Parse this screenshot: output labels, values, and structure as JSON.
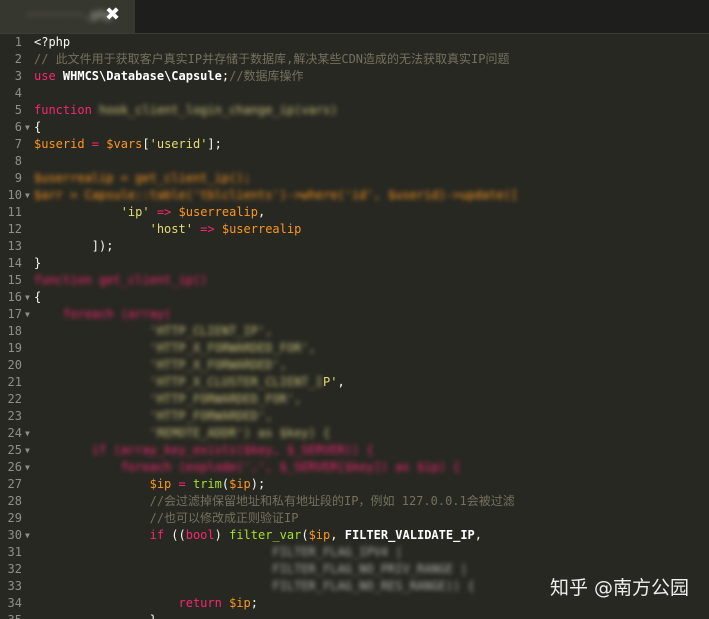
{
  "tab": {
    "title": "········.php",
    "close_icon": "close-icon"
  },
  "watermark": "知乎 @南方公园",
  "lines": [
    {
      "n": "1",
      "fold": false,
      "parts": [
        {
          "c": "pl",
          "t": "<?php"
        }
      ]
    },
    {
      "n": "2",
      "fold": false,
      "parts": [
        {
          "c": "cmt",
          "t": "// 此文件用于获取客户真实IP并存储于数据库,解决某些CDN造成的无法获取真实IP问题"
        }
      ]
    },
    {
      "n": "3",
      "fold": false,
      "parts": [
        {
          "c": "kw",
          "t": "use "
        },
        {
          "c": "cls",
          "t": "WHMCS\\Database\\Capsule"
        },
        {
          "c": "pl",
          "t": ";"
        },
        {
          "c": "cmt",
          "t": "//数据库操作"
        }
      ]
    },
    {
      "n": "4",
      "fold": false,
      "parts": []
    },
    {
      "n": "5",
      "fold": false,
      "parts": [
        {
          "c": "kw",
          "t": "function "
        },
        {
          "c": "blur",
          "t": "hook_client_login_change_ip(vars)"
        }
      ]
    },
    {
      "n": "6",
      "fold": true,
      "parts": [
        {
          "c": "pl",
          "t": "{"
        }
      ]
    },
    {
      "n": "7",
      "fold": false,
      "parts": [
        {
          "c": "var",
          "t": "$userid"
        },
        {
          "c": "op",
          "t": " = "
        },
        {
          "c": "var",
          "t": "$vars"
        },
        {
          "c": "pl",
          "t": "["
        },
        {
          "c": "str",
          "t": "'userid'"
        },
        {
          "c": "pl",
          "t": "];"
        }
      ]
    },
    {
      "n": "8",
      "fold": false,
      "parts": []
    },
    {
      "n": "9",
      "fold": false,
      "parts": [
        {
          "c": "blurv",
          "t": "$userrealip = get_client_ip();"
        }
      ]
    },
    {
      "n": "10",
      "fold": true,
      "parts": [
        {
          "c": "blurv",
          "t": "$arr = Capsule::table('tblclients')->where('id', $userid)->update(["
        }
      ]
    },
    {
      "n": "11",
      "fold": false,
      "parts": [
        {
          "c": "pl",
          "t": "            "
        },
        {
          "c": "str",
          "t": "'ip'"
        },
        {
          "c": "op",
          "t": " => "
        },
        {
          "c": "var",
          "t": "$userrealip"
        },
        {
          "c": "pl",
          "t": ","
        }
      ]
    },
    {
      "n": "12",
      "fold": false,
      "parts": [
        {
          "c": "pl",
          "t": "                "
        },
        {
          "c": "str",
          "t": "'host'"
        },
        {
          "c": "op",
          "t": " => "
        },
        {
          "c": "var",
          "t": "$userrealip"
        }
      ]
    },
    {
      "n": "13",
      "fold": false,
      "parts": [
        {
          "c": "pl",
          "t": "        ]);"
        }
      ]
    },
    {
      "n": "14",
      "fold": false,
      "parts": [
        {
          "c": "pl",
          "t": "}"
        }
      ]
    },
    {
      "n": "15",
      "fold": false,
      "parts": [
        {
          "c": "blurr",
          "t": "function get_client_ip()"
        }
      ]
    },
    {
      "n": "16",
      "fold": true,
      "parts": [
        {
          "c": "pl",
          "t": "{"
        }
      ]
    },
    {
      "n": "17",
      "fold": true,
      "parts": [
        {
          "c": "pl",
          "t": "    "
        },
        {
          "c": "blurr",
          "t": "foreach (array("
        }
      ]
    },
    {
      "n": "18",
      "fold": false,
      "parts": [
        {
          "c": "pl",
          "t": "                "
        },
        {
          "c": "blur",
          "t": "'HTTP_CLIENT_IP',"
        }
      ]
    },
    {
      "n": "19",
      "fold": false,
      "parts": [
        {
          "c": "pl",
          "t": "                "
        },
        {
          "c": "blur",
          "t": "'HTTP_X_FORWARDED_FOR',"
        }
      ]
    },
    {
      "n": "20",
      "fold": false,
      "parts": [
        {
          "c": "pl",
          "t": "                "
        },
        {
          "c": "blur",
          "t": "'HTTP_X_FORWARDED',"
        }
      ]
    },
    {
      "n": "21",
      "fold": false,
      "parts": [
        {
          "c": "pl",
          "t": "                "
        },
        {
          "c": "blur",
          "t": "'HTTP_X_CLUSTER_CLIENT_I"
        },
        {
          "c": "str",
          "t": "P'"
        },
        {
          "c": "pl",
          "t": ","
        }
      ]
    },
    {
      "n": "22",
      "fold": false,
      "parts": [
        {
          "c": "pl",
          "t": "                "
        },
        {
          "c": "blur",
          "t": "'HTTP_FORWARDED_FOR',"
        }
      ]
    },
    {
      "n": "23",
      "fold": false,
      "parts": [
        {
          "c": "pl",
          "t": "                "
        },
        {
          "c": "blur",
          "t": "'HTTP_FORWARDED',"
        }
      ]
    },
    {
      "n": "24",
      "fold": true,
      "parts": [
        {
          "c": "pl",
          "t": "                "
        },
        {
          "c": "blur",
          "t": "'REMOTE_ADDR') as $key) {"
        }
      ]
    },
    {
      "n": "25",
      "fold": true,
      "parts": [
        {
          "c": "pl",
          "t": "        "
        },
        {
          "c": "blurr",
          "t": "if (array_key_exists($key, $_SERVER)) {"
        }
      ]
    },
    {
      "n": "26",
      "fold": true,
      "parts": [
        {
          "c": "pl",
          "t": "            "
        },
        {
          "c": "blurr",
          "t": "foreach (explode(',', $_SERVER[$key]) as $ip) {"
        }
      ]
    },
    {
      "n": "27",
      "fold": false,
      "parts": [
        {
          "c": "pl",
          "t": "                "
        },
        {
          "c": "var",
          "t": "$ip"
        },
        {
          "c": "op",
          "t": " = "
        },
        {
          "c": "fn",
          "t": "trim"
        },
        {
          "c": "pl",
          "t": "("
        },
        {
          "c": "var",
          "t": "$ip"
        },
        {
          "c": "pl",
          "t": ");"
        }
      ]
    },
    {
      "n": "28",
      "fold": false,
      "parts": [
        {
          "c": "pl",
          "t": "                "
        },
        {
          "c": "cmt",
          "t": "//会过滤掉保留地址和私有地址段的IP，例如 127.0.0.1会被过滤"
        }
      ]
    },
    {
      "n": "29",
      "fold": false,
      "parts": [
        {
          "c": "pl",
          "t": "                "
        },
        {
          "c": "cmt",
          "t": "//也可以修改成正则验证IP"
        }
      ]
    },
    {
      "n": "30",
      "fold": true,
      "parts": [
        {
          "c": "pl",
          "t": "                "
        },
        {
          "c": "kw",
          "t": "if "
        },
        {
          "c": "pl",
          "t": "(("
        },
        {
          "c": "kw",
          "t": "bool"
        },
        {
          "c": "pl",
          "t": ") "
        },
        {
          "c": "fn",
          "t": "filter_var"
        },
        {
          "c": "pl",
          "t": "("
        },
        {
          "c": "var",
          "t": "$ip"
        },
        {
          "c": "pl",
          "t": ", "
        },
        {
          "c": "cls",
          "t": "FILTER_VALIDATE_IP"
        },
        {
          "c": "pl",
          "t": ","
        }
      ]
    },
    {
      "n": "31",
      "fold": false,
      "parts": [
        {
          "c": "pl",
          "t": "                                 "
        },
        {
          "c": "blurg",
          "t": "FILTER_FLAG_IPV4 |"
        }
      ]
    },
    {
      "n": "32",
      "fold": false,
      "parts": [
        {
          "c": "pl",
          "t": "                                 "
        },
        {
          "c": "blurg",
          "t": "FILTER_FLAG_NO_PRIV_RANGE |"
        }
      ]
    },
    {
      "n": "33",
      "fold": false,
      "parts": [
        {
          "c": "pl",
          "t": "                                 "
        },
        {
          "c": "blurg",
          "t": "FILTER_FLAG_NO_RES_RANGE)) {"
        }
      ]
    },
    {
      "n": "34",
      "fold": false,
      "parts": [
        {
          "c": "pl",
          "t": "                    "
        },
        {
          "c": "kw",
          "t": "return "
        },
        {
          "c": "var",
          "t": "$ip"
        },
        {
          "c": "pl",
          "t": ";"
        }
      ]
    },
    {
      "n": "35",
      "fold": false,
      "parts": [
        {
          "c": "pl",
          "t": "                }"
        }
      ]
    }
  ]
}
